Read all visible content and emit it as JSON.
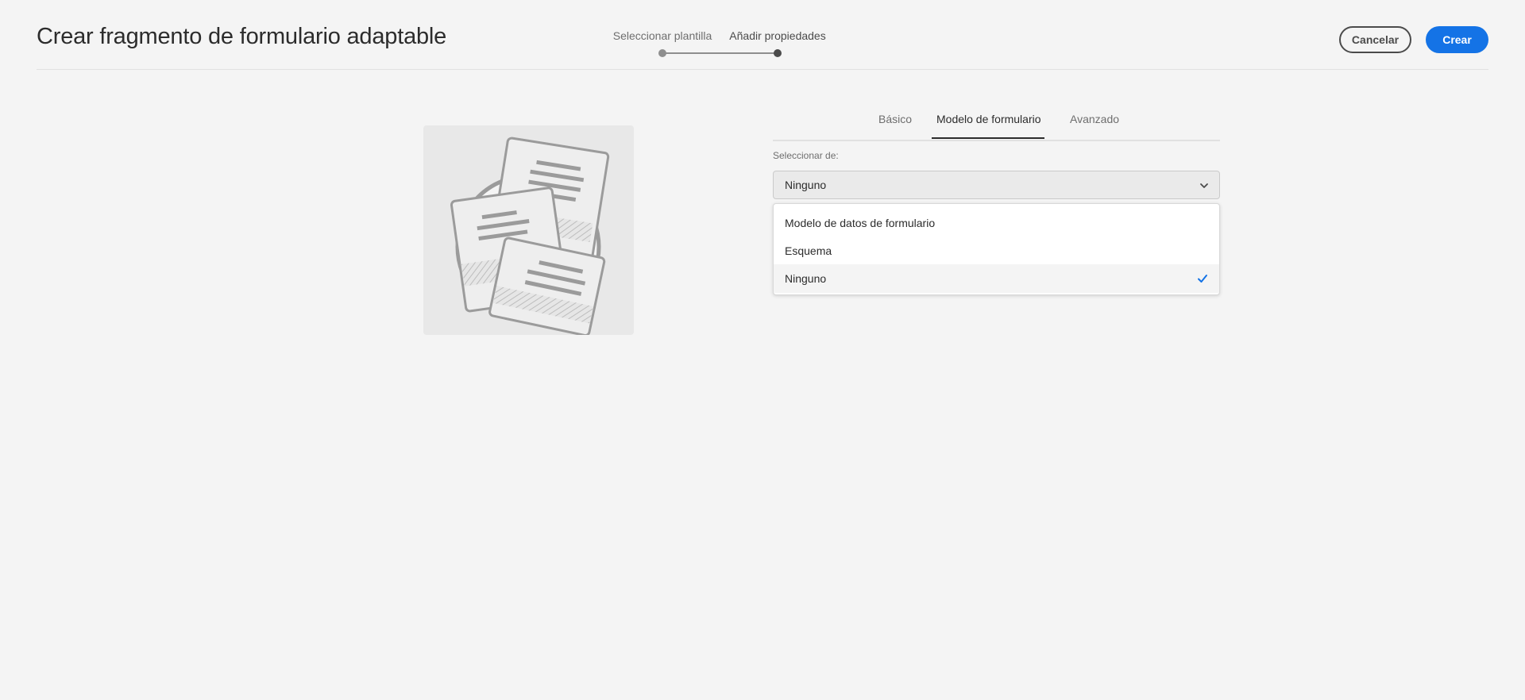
{
  "header": {
    "title": "Crear fragmento de formulario adaptable",
    "steps": [
      {
        "label": "Seleccionar plantilla",
        "state": "done"
      },
      {
        "label": "Añadir propiedades",
        "state": "current"
      }
    ],
    "cancel_label": "Cancelar",
    "create_label": "Crear"
  },
  "preview": {
    "icon": "form-fragment-illustration"
  },
  "tabs": [
    {
      "label": "Básico",
      "active": false
    },
    {
      "label": "Modelo de formulario",
      "active": true
    },
    {
      "label": "Avanzado",
      "active": false
    }
  ],
  "form_model": {
    "select_label": "Seleccionar de:",
    "selected_value": "Ninguno",
    "options": [
      {
        "label": "Modelo de datos de formulario",
        "selected": false
      },
      {
        "label": "Esquema",
        "selected": false
      },
      {
        "label": "Ninguno",
        "selected": true
      }
    ]
  },
  "colors": {
    "accent": "#1473e6",
    "background": "#f4f4f4",
    "text": "#2c2c2c",
    "muted": "#6e6e6e"
  }
}
